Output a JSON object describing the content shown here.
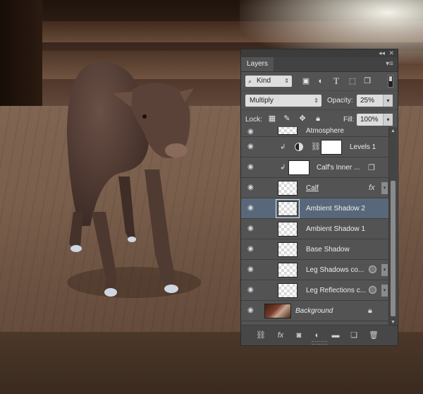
{
  "panel": {
    "collapse_glyph": "◂◂",
    "close_glyph": "✕",
    "tab_label": "Layers",
    "menu_glyph": "▾≡",
    "filter": {
      "kind_label": "Kind",
      "icons": [
        "image-filter-icon",
        "adjustment-filter-icon",
        "type-filter-icon",
        "shape-filter-icon",
        "smart-object-filter-icon"
      ]
    },
    "blend_mode": "Multiply",
    "opacity_label": "Opacity:",
    "opacity_value": "25%",
    "lock_label": "Lock:",
    "fill_label": "Fill:",
    "fill_value": "100%",
    "layers": [
      {
        "name": "Atmosphere",
        "kind": "partial"
      },
      {
        "name": "Levels 1",
        "kind": "adjustment"
      },
      {
        "name": "Calf's Inner ...",
        "kind": "clipped-mask"
      },
      {
        "name": "Calf",
        "kind": "smart",
        "fx": "fx"
      },
      {
        "name": "Ambient Shadow 2",
        "kind": "normal",
        "selected": true
      },
      {
        "name": "Ambient Shadow 1",
        "kind": "normal"
      },
      {
        "name": "Base Shadow",
        "kind": "normal"
      },
      {
        "name": "Leg Shadows co...",
        "kind": "smart-badge"
      },
      {
        "name": "Leg Reflections c...",
        "kind": "smart-badge"
      },
      {
        "name": "Background",
        "kind": "background"
      }
    ],
    "bottom_icons": [
      "link-icon",
      "fx-icon",
      "mask-icon",
      "adjustment-icon",
      "folder-icon",
      "new-layer-icon",
      "trash-icon"
    ],
    "fx_label": "fx"
  },
  "colors": {
    "panel_bg": "#535353",
    "selected_row": "#58687a"
  }
}
